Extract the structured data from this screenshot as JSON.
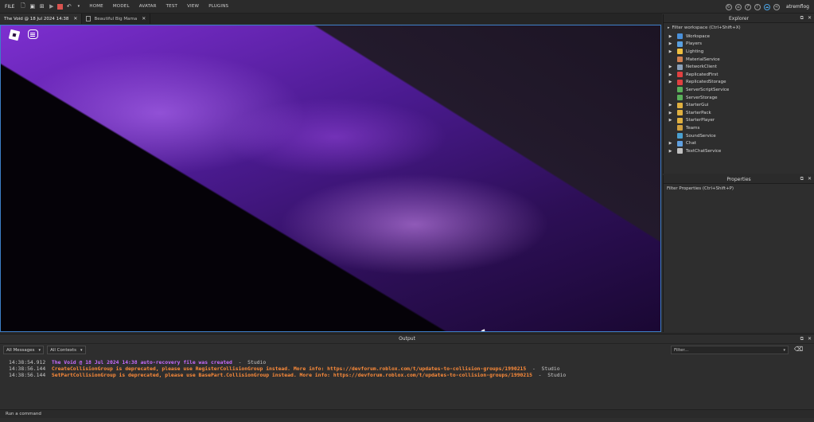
{
  "menubar": {
    "file": "FILE",
    "tabs": [
      "HOME",
      "MODEL",
      "AVATAR",
      "TEST",
      "VIEW",
      "PLUGINS"
    ],
    "username": "atremflog"
  },
  "doc_tabs": [
    {
      "label": "The Void @ 18 Jul 2024 14:38"
    },
    {
      "label": "Beautiful Big Mama"
    }
  ],
  "explorer": {
    "title": "Explorer",
    "filter_placeholder": "Filter workspace (Ctrl+Shift+X)",
    "items": [
      {
        "label": "Workspace",
        "expandable": true,
        "color": "#4a90d9"
      },
      {
        "label": "Players",
        "expandable": true,
        "color": "#5aa0e0"
      },
      {
        "label": "Lighting",
        "expandable": true,
        "color": "#f0c040"
      },
      {
        "label": "MaterialService",
        "expandable": false,
        "color": "#d08050"
      },
      {
        "label": "NetworkClient",
        "expandable": true,
        "color": "#8aa0b8"
      },
      {
        "label": "ReplicatedFirst",
        "expandable": true,
        "color": "#e04040"
      },
      {
        "label": "ReplicatedStorage",
        "expandable": true,
        "color": "#e04040"
      },
      {
        "label": "ServerScriptService",
        "expandable": false,
        "color": "#5ab05a"
      },
      {
        "label": "ServerStorage",
        "expandable": false,
        "color": "#5ab05a"
      },
      {
        "label": "StarterGui",
        "expandable": true,
        "color": "#e0b040"
      },
      {
        "label": "StarterPack",
        "expandable": true,
        "color": "#e0b040"
      },
      {
        "label": "StarterPlayer",
        "expandable": true,
        "color": "#e0b040"
      },
      {
        "label": "Teams",
        "expandable": false,
        "color": "#d0a040"
      },
      {
        "label": "SoundService",
        "expandable": false,
        "color": "#4aa0d0"
      },
      {
        "label": "Chat",
        "expandable": true,
        "color": "#60a0e0"
      },
      {
        "label": "TextChatService",
        "expandable": true,
        "color": "#c0c0c0"
      }
    ]
  },
  "properties": {
    "title": "Properties",
    "filter_placeholder": "Filter Properties (Ctrl+Shift+P)"
  },
  "output": {
    "title": "Output",
    "messages_filter": "All Messages",
    "contexts_filter": "All Contexts",
    "search_placeholder": "Filter...",
    "lines": [
      {
        "time": "14:38:54.912",
        "text": "The Void @ 18 Jul 2024 14:38 auto-recovery file was created",
        "source": "Studio",
        "color": "#c86cff"
      },
      {
        "time": "14:38:56.144",
        "text": "CreateCollisionGroup is deprecated, please use RegisterCollisionGroup instead. More info: https://devforum.roblox.com/t/updates-to-collision-groups/1990215",
        "source": "Studio",
        "color": "#ff8c3a"
      },
      {
        "time": "14:38:56.144",
        "text": "SetPartCollisionGroup is deprecated, please use BasePart.CollisionGroup instead. More info: https://devforum.roblox.com/t/updates-to-collision-groups/1990215",
        "source": "Studio",
        "color": "#ff8c3a"
      }
    ],
    "command_placeholder": "Run a command"
  }
}
